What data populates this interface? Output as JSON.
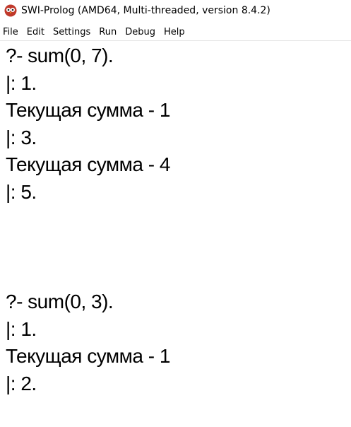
{
  "window": {
    "title": "SWI-Prolog (AMD64, Multi-threaded, version 8.4.2)",
    "icon": "swi-prolog-owl-icon",
    "accent_color": "#c0392b"
  },
  "menu": {
    "items": [
      "File",
      "Edit",
      "Settings",
      "Run",
      "Debug",
      "Help"
    ]
  },
  "console": {
    "lines": [
      "?- sum(0, 7).",
      "|: 1.",
      "Текущая сумма - 1",
      "|: 3.",
      "Текущая сумма - 4",
      "|: 5.",
      "?- sum(0, 3).",
      "|: 1.",
      "Текущая сумма - 1",
      "|: 2."
    ]
  }
}
